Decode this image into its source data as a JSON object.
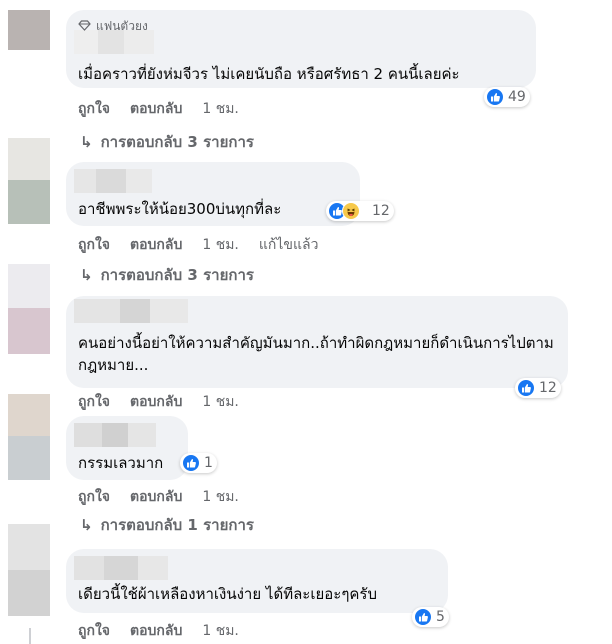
{
  "fan_badge": "แฟนตัวยง",
  "comments": [
    {
      "text": "เมื่อคราวที่ยังห่มจีวร ไม่เคยนับถือ หรือศรัทธา 2 คนนี้เลยค่ะ",
      "reaction_count": "49",
      "reactions": [
        "like"
      ],
      "actions": {
        "like": "ถูกใจ",
        "reply": "ตอบกลับ",
        "time": "1 ชม."
      },
      "replies_label": "การตอบกลับ 3 รายการ"
    },
    {
      "text": "อาชีพพระให้น้อย300บ่นทุกที่ละ",
      "reaction_count": "12",
      "reactions": [
        "like",
        "haha"
      ],
      "actions": {
        "like": "ถูกใจ",
        "reply": "ตอบกลับ",
        "time": "1 ชม.",
        "edited": "แก้ไขแล้ว"
      },
      "replies_label": "การตอบกลับ 3 รายการ"
    },
    {
      "text": "คนอย่างนี้อย่าให้ความสำคัญมันมาก..ถ้าทำผิดกฎหมายก็ดำเนินการไปตามกฎหมาย...",
      "reaction_count": "12",
      "reactions": [
        "like"
      ],
      "actions": {
        "like": "ถูกใจ",
        "reply": "ตอบกลับ",
        "time": "1 ชม."
      }
    },
    {
      "text": "กรรมเลวมาก",
      "reaction_count": "1",
      "reactions": [
        "like"
      ],
      "actions": {
        "like": "ถูกใจ",
        "reply": "ตอบกลับ",
        "time": "1 ชม."
      },
      "replies_label": "การตอบกลับ 1 รายการ"
    },
    {
      "text": "เดียวนี้ใช้ผ้าเหลืองหาเงินง่าย ได้ทีละเยอะๆครับ",
      "reaction_count": "5",
      "reactions": [
        "like"
      ],
      "actions": {
        "like": "ถูกใจ",
        "reply": "ตอบกลับ",
        "time": "1 ชม."
      }
    }
  ],
  "colors": {
    "bubble": "#f0f2f5",
    "muted_text": "#65676b",
    "like_blue": "#1877f2",
    "haha_yellow": "#f7c94b"
  }
}
